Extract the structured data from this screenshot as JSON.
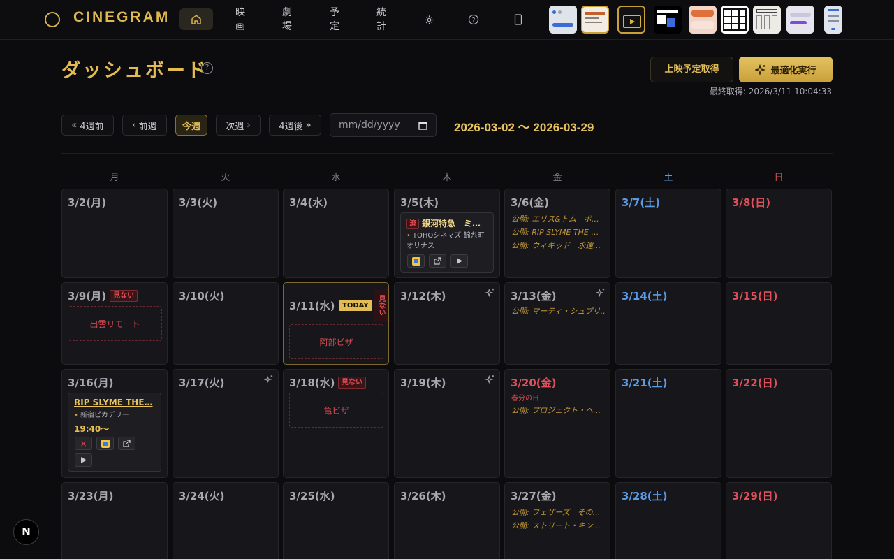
{
  "nav": {
    "logo": "CINEGRAM",
    "movies": "映画",
    "theaters": "劇場",
    "schedule": "予定",
    "stats": "統計"
  },
  "header": {
    "title": "ダッシュボード",
    "help": "?",
    "fetch_btn": "上映予定取得",
    "optimize_btn": "最適化実行",
    "last_fetch": "最終取得: 2026/3/11 10:04:33"
  },
  "week_nav": {
    "back4": "4週前",
    "prev": "前週",
    "this_week": "今週",
    "next": "次週",
    "forward4": "4週後",
    "date_placeholder": "mm/dd/yyyy",
    "range": "2026-03-02 〜 2026-03-29"
  },
  "weekdays": [
    "月",
    "火",
    "水",
    "木",
    "金",
    "土",
    "日"
  ],
  "days": [
    "3/2(月)",
    "3/3(火)",
    "3/4(水)",
    "3/5(木)",
    "3/6(金)",
    "3/7(土)",
    "3/8(日)",
    "3/9(月)",
    "3/10(火)",
    "3/11(水)",
    "3/12(木)",
    "3/13(金)",
    "3/14(土)",
    "3/15(日)",
    "3/16(月)",
    "3/17(火)",
    "3/18(水)",
    "3/19(木)",
    "3/20(金)",
    "3/21(土)",
    "3/22(日)",
    "3/23(月)",
    "3/24(火)",
    "3/25(水)",
    "3/26(木)",
    "3/27(金)",
    "3/28(土)",
    "3/29(日)"
  ],
  "badges": {
    "not_watching": "見ない",
    "today": "TODAY",
    "done": "済",
    "holiday": "春分の日"
  },
  "ng": {
    "d1": "出雲リモート",
    "d2": "阿部ビザ",
    "d3": "亀ビザ"
  },
  "events": {
    "e1": {
      "title": "銀河特急　ミ…",
      "theater_l1": "TOHOシネマズ 錦糸町",
      "theater_l2": "オリナス"
    },
    "e2": {
      "title": "RIP SLYME THE…",
      "theater": "新宿ピカデリー",
      "time": "19:40〜"
    }
  },
  "releases": {
    "r1": "公開: エリス&トム　ボ…",
    "r2": "公開: RIP SLYME THE …",
    "r3": "公開: ウィキッド　永遠…",
    "r4": "公開: マーティ・シュプリ…",
    "r5": "公開: プロジェクト・ヘ…",
    "r6": "公開: フェザーズ　その…",
    "r7": "公開: ストリート・キン…"
  },
  "colors": {
    "accent": "#e3bb52",
    "saturday": "#5a9be6",
    "sunday": "#e0505a",
    "not_watching": "#e24c54"
  },
  "floating": {
    "next_logo": "N"
  }
}
